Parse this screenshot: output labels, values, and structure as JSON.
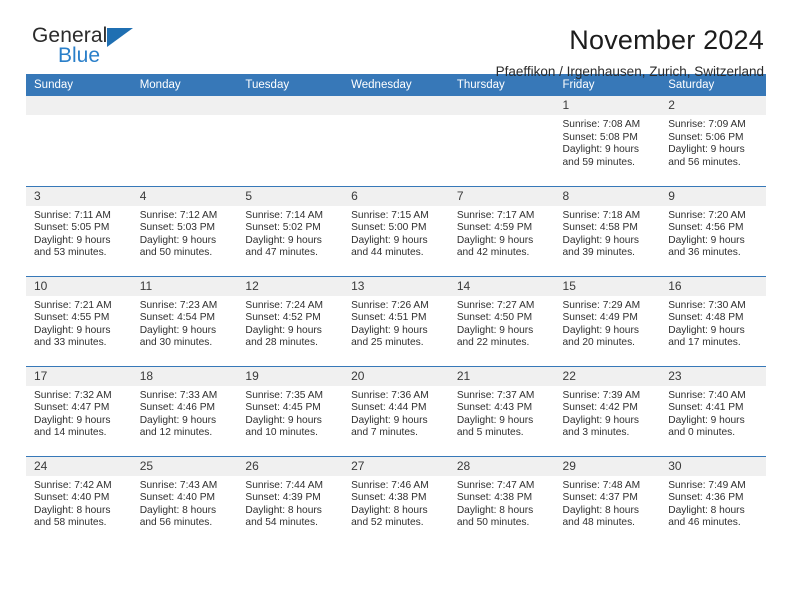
{
  "brand": {
    "name_part1": "General",
    "name_part2": "Blue",
    "triangle_color": "#1f6fb2",
    "blue_color": "#2a7fc9"
  },
  "header": {
    "title": "November 2024",
    "subtitle": "Pfaeffikon / Irgenhausen, Zurich, Switzerland"
  },
  "theme": {
    "header_band": "#3778b8",
    "day_band": "#f0f0f0",
    "text": "#2f2f2f"
  },
  "weekday_headers": [
    "Sunday",
    "Monday",
    "Tuesday",
    "Wednesday",
    "Thursday",
    "Friday",
    "Saturday"
  ],
  "weeks": [
    [
      {
        "empty": true
      },
      {
        "empty": true
      },
      {
        "empty": true
      },
      {
        "empty": true
      },
      {
        "empty": true
      },
      {
        "day": "1",
        "sunrise": "Sunrise: 7:08 AM",
        "sunset": "Sunset: 5:08 PM",
        "daylight_line1": "Daylight: 9 hours",
        "daylight_line2": "and 59 minutes."
      },
      {
        "day": "2",
        "sunrise": "Sunrise: 7:09 AM",
        "sunset": "Sunset: 5:06 PM",
        "daylight_line1": "Daylight: 9 hours",
        "daylight_line2": "and 56 minutes."
      }
    ],
    [
      {
        "day": "3",
        "sunrise": "Sunrise: 7:11 AM",
        "sunset": "Sunset: 5:05 PM",
        "daylight_line1": "Daylight: 9 hours",
        "daylight_line2": "and 53 minutes."
      },
      {
        "day": "4",
        "sunrise": "Sunrise: 7:12 AM",
        "sunset": "Sunset: 5:03 PM",
        "daylight_line1": "Daylight: 9 hours",
        "daylight_line2": "and 50 minutes."
      },
      {
        "day": "5",
        "sunrise": "Sunrise: 7:14 AM",
        "sunset": "Sunset: 5:02 PM",
        "daylight_line1": "Daylight: 9 hours",
        "daylight_line2": "and 47 minutes."
      },
      {
        "day": "6",
        "sunrise": "Sunrise: 7:15 AM",
        "sunset": "Sunset: 5:00 PM",
        "daylight_line1": "Daylight: 9 hours",
        "daylight_line2": "and 44 minutes."
      },
      {
        "day": "7",
        "sunrise": "Sunrise: 7:17 AM",
        "sunset": "Sunset: 4:59 PM",
        "daylight_line1": "Daylight: 9 hours",
        "daylight_line2": "and 42 minutes."
      },
      {
        "day": "8",
        "sunrise": "Sunrise: 7:18 AM",
        "sunset": "Sunset: 4:58 PM",
        "daylight_line1": "Daylight: 9 hours",
        "daylight_line2": "and 39 minutes."
      },
      {
        "day": "9",
        "sunrise": "Sunrise: 7:20 AM",
        "sunset": "Sunset: 4:56 PM",
        "daylight_line1": "Daylight: 9 hours",
        "daylight_line2": "and 36 minutes."
      }
    ],
    [
      {
        "day": "10",
        "sunrise": "Sunrise: 7:21 AM",
        "sunset": "Sunset: 4:55 PM",
        "daylight_line1": "Daylight: 9 hours",
        "daylight_line2": "and 33 minutes."
      },
      {
        "day": "11",
        "sunrise": "Sunrise: 7:23 AM",
        "sunset": "Sunset: 4:54 PM",
        "daylight_line1": "Daylight: 9 hours",
        "daylight_line2": "and 30 minutes."
      },
      {
        "day": "12",
        "sunrise": "Sunrise: 7:24 AM",
        "sunset": "Sunset: 4:52 PM",
        "daylight_line1": "Daylight: 9 hours",
        "daylight_line2": "and 28 minutes."
      },
      {
        "day": "13",
        "sunrise": "Sunrise: 7:26 AM",
        "sunset": "Sunset: 4:51 PM",
        "daylight_line1": "Daylight: 9 hours",
        "daylight_line2": "and 25 minutes."
      },
      {
        "day": "14",
        "sunrise": "Sunrise: 7:27 AM",
        "sunset": "Sunset: 4:50 PM",
        "daylight_line1": "Daylight: 9 hours",
        "daylight_line2": "and 22 minutes."
      },
      {
        "day": "15",
        "sunrise": "Sunrise: 7:29 AM",
        "sunset": "Sunset: 4:49 PM",
        "daylight_line1": "Daylight: 9 hours",
        "daylight_line2": "and 20 minutes."
      },
      {
        "day": "16",
        "sunrise": "Sunrise: 7:30 AM",
        "sunset": "Sunset: 4:48 PM",
        "daylight_line1": "Daylight: 9 hours",
        "daylight_line2": "and 17 minutes."
      }
    ],
    [
      {
        "day": "17",
        "sunrise": "Sunrise: 7:32 AM",
        "sunset": "Sunset: 4:47 PM",
        "daylight_line1": "Daylight: 9 hours",
        "daylight_line2": "and 14 minutes."
      },
      {
        "day": "18",
        "sunrise": "Sunrise: 7:33 AM",
        "sunset": "Sunset: 4:46 PM",
        "daylight_line1": "Daylight: 9 hours",
        "daylight_line2": "and 12 minutes."
      },
      {
        "day": "19",
        "sunrise": "Sunrise: 7:35 AM",
        "sunset": "Sunset: 4:45 PM",
        "daylight_line1": "Daylight: 9 hours",
        "daylight_line2": "and 10 minutes."
      },
      {
        "day": "20",
        "sunrise": "Sunrise: 7:36 AM",
        "sunset": "Sunset: 4:44 PM",
        "daylight_line1": "Daylight: 9 hours",
        "daylight_line2": "and 7 minutes."
      },
      {
        "day": "21",
        "sunrise": "Sunrise: 7:37 AM",
        "sunset": "Sunset: 4:43 PM",
        "daylight_line1": "Daylight: 9 hours",
        "daylight_line2": "and 5 minutes."
      },
      {
        "day": "22",
        "sunrise": "Sunrise: 7:39 AM",
        "sunset": "Sunset: 4:42 PM",
        "daylight_line1": "Daylight: 9 hours",
        "daylight_line2": "and 3 minutes."
      },
      {
        "day": "23",
        "sunrise": "Sunrise: 7:40 AM",
        "sunset": "Sunset: 4:41 PM",
        "daylight_line1": "Daylight: 9 hours",
        "daylight_line2": "and 0 minutes."
      }
    ],
    [
      {
        "day": "24",
        "sunrise": "Sunrise: 7:42 AM",
        "sunset": "Sunset: 4:40 PM",
        "daylight_line1": "Daylight: 8 hours",
        "daylight_line2": "and 58 minutes."
      },
      {
        "day": "25",
        "sunrise": "Sunrise: 7:43 AM",
        "sunset": "Sunset: 4:40 PM",
        "daylight_line1": "Daylight: 8 hours",
        "daylight_line2": "and 56 minutes."
      },
      {
        "day": "26",
        "sunrise": "Sunrise: 7:44 AM",
        "sunset": "Sunset: 4:39 PM",
        "daylight_line1": "Daylight: 8 hours",
        "daylight_line2": "and 54 minutes."
      },
      {
        "day": "27",
        "sunrise": "Sunrise: 7:46 AM",
        "sunset": "Sunset: 4:38 PM",
        "daylight_line1": "Daylight: 8 hours",
        "daylight_line2": "and 52 minutes."
      },
      {
        "day": "28",
        "sunrise": "Sunrise: 7:47 AM",
        "sunset": "Sunset: 4:38 PM",
        "daylight_line1": "Daylight: 8 hours",
        "daylight_line2": "and 50 minutes."
      },
      {
        "day": "29",
        "sunrise": "Sunrise: 7:48 AM",
        "sunset": "Sunset: 4:37 PM",
        "daylight_line1": "Daylight: 8 hours",
        "daylight_line2": "and 48 minutes."
      },
      {
        "day": "30",
        "sunrise": "Sunrise: 7:49 AM",
        "sunset": "Sunset: 4:36 PM",
        "daylight_line1": "Daylight: 8 hours",
        "daylight_line2": "and 46 minutes."
      }
    ]
  ]
}
